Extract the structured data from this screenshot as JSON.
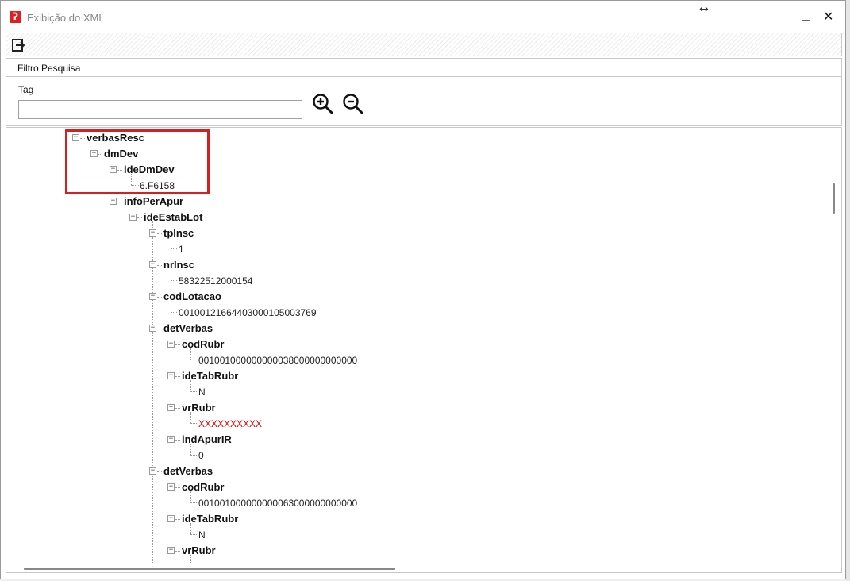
{
  "window": {
    "title": "Exibição do XML",
    "icon": "app-logo-icon",
    "resize_glyph": "↔",
    "minimize_glyph": "_",
    "close_glyph": "✕"
  },
  "toolbar": {
    "exit_icon": "exit-icon"
  },
  "filter": {
    "title": "Filtro Pesquisa",
    "tag_label": "Tag",
    "tag_value": "",
    "zoom_in_icon": "zoom-in-icon",
    "zoom_out_icon": "zoom-out-icon"
  },
  "tree": {
    "highlight_color": "#d42020",
    "nodes": {
      "verbasResc": "verbasResc",
      "dmDev": "dmDev",
      "ideDmDev": "ideDmDev",
      "ideDmDev_value": "6.F6158",
      "infoPerApur": "infoPerApur",
      "ideEstabLot": "ideEstabLot",
      "tpInsc": "tpInsc",
      "tpInsc_value": "1",
      "nrInsc": "nrInsc",
      "nrInsc_value": "58322512000154",
      "codLotacao": "codLotacao",
      "codLotacao_value": "001001216644030001050037 69",
      "detVerbas1": "detVerbas",
      "codRubr1": "codRubr",
      "codRubr1_value": "001001000000000038000000000000",
      "ideTabRubr1": "ideTabRubr",
      "ideTabRubr1_value": "N",
      "vrRubr1": "vrRubr",
      "vrRubr1_value": "XXXXXXXXXX",
      "indApurIR": "indApurIR",
      "indApurIR_value": "0",
      "detVerbas2": "detVerbas",
      "codRubr2": "codRubr",
      "codRubr2_value": "001001000000000063000000000000",
      "ideTabRubr2": "ideTabRubr",
      "ideTabRubr2_value": "N",
      "vrRubr2": "vrRubr"
    }
  }
}
